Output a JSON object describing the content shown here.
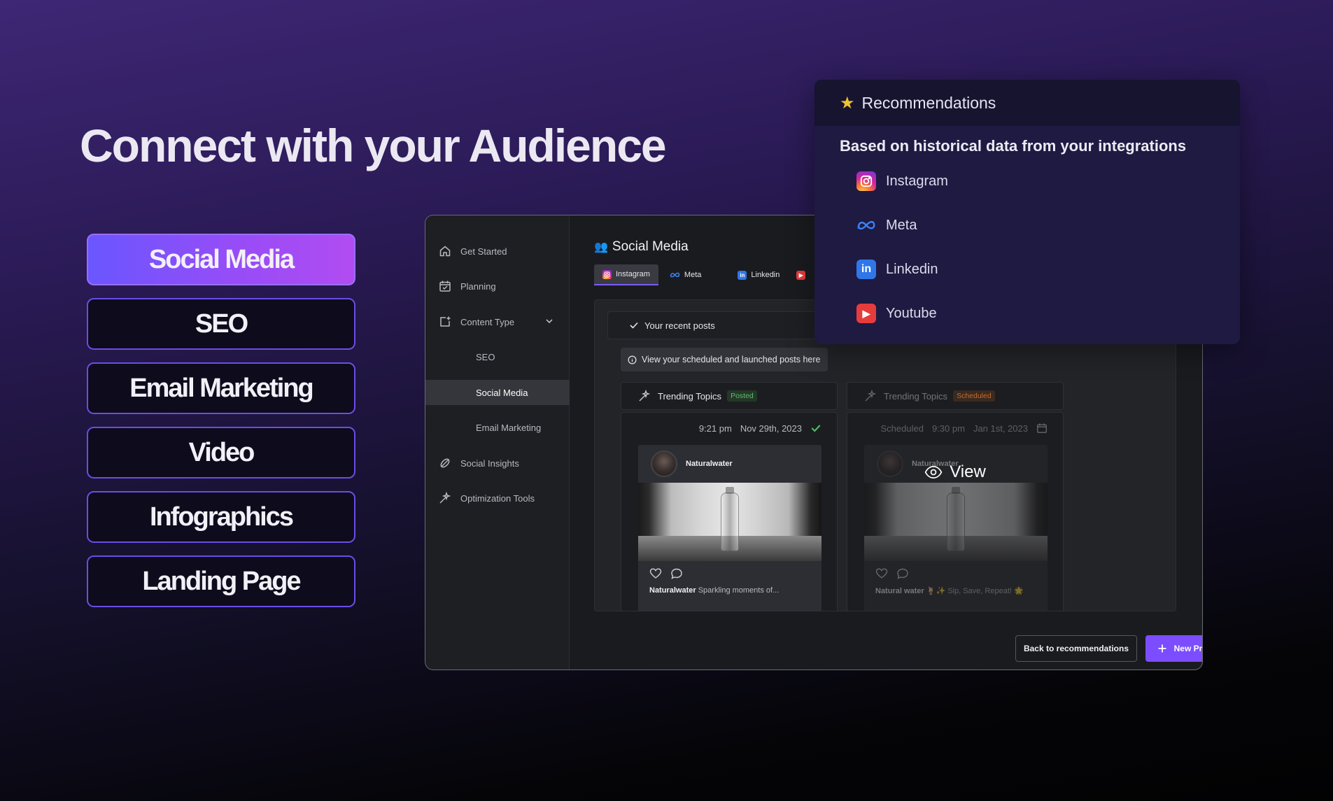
{
  "headline": "Connect with your Audience",
  "categories": [
    {
      "label": "Social Media",
      "active": true
    },
    {
      "label": "SEO"
    },
    {
      "label": "Email Marketing"
    },
    {
      "label": "Video"
    },
    {
      "label": "Infographics"
    },
    {
      "label": "Landing Page"
    }
  ],
  "sidebar": {
    "items": [
      {
        "label": "Get Started",
        "icon": "home-icon"
      },
      {
        "label": "Planning",
        "icon": "calendar-check-icon"
      },
      {
        "label": "Content Type",
        "icon": "add-content-icon"
      },
      {
        "label": "SEO"
      },
      {
        "label": "Social Media",
        "selected": true
      },
      {
        "label": "Email Marketing"
      },
      {
        "label": "Social Insights",
        "icon": "insights-icon"
      },
      {
        "label": "Optimization Tools",
        "icon": "magic-wand-icon"
      }
    ]
  },
  "main": {
    "title_emoji": "👥",
    "title": "Social Media",
    "tabs": [
      {
        "label": "Instagram",
        "active": true
      },
      {
        "label": "Meta"
      },
      {
        "label": "Linkedin"
      }
    ],
    "recent_posts_label": "Your recent posts",
    "info_text": "View your scheduled and launched posts here",
    "cards": [
      {
        "title": "Trending Topics",
        "badge": "Posted",
        "time": "9:21 pm",
        "date": "Nov 29th, 2023",
        "account": "Naturalwater",
        "caption_user": "Naturalwater",
        "caption_text": "Sparkling moments of..."
      },
      {
        "title": "Trending Topics",
        "badge": "Scheduled",
        "status": "Scheduled",
        "time": "9:30 pm",
        "date": "Jan 1st, 2023",
        "account": "Naturalwater",
        "caption_user": "Natural water",
        "caption_text": "🍹✨ Sip, Save, Repeat! 🌟",
        "overlay": "View"
      }
    ],
    "back_button": "Back to recommendations",
    "new_project_button": "New Project"
  },
  "recommendations": {
    "title": "Recommendations",
    "subtitle": "Based on historical data from your integrations",
    "integrations": [
      {
        "label": "Instagram",
        "icon": "instagram-icon"
      },
      {
        "label": "Meta",
        "icon": "meta-icon"
      },
      {
        "label": "Linkedin",
        "icon": "linkedin-icon"
      },
      {
        "label": "Youtube",
        "icon": "youtube-icon"
      }
    ]
  },
  "colors": {
    "accent": "#7c4dff",
    "posted": "#5fbf6a",
    "scheduled": "#c76b2e"
  }
}
